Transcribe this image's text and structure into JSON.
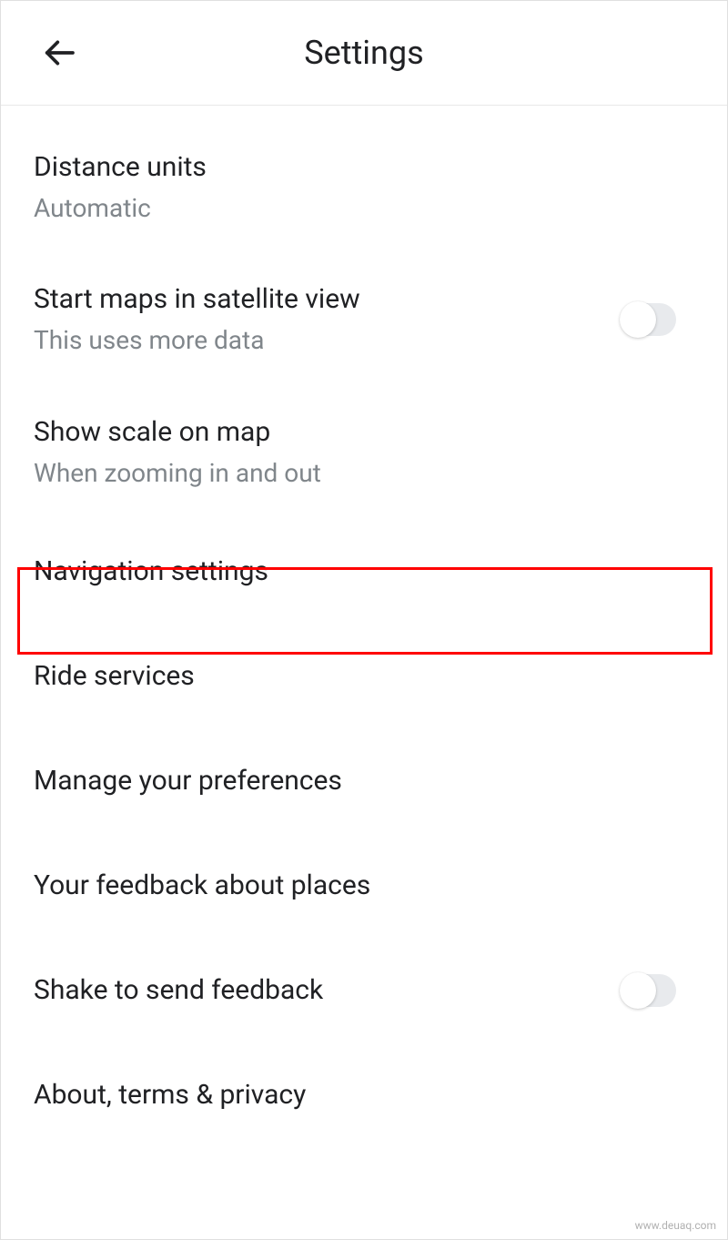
{
  "header": {
    "title": "Settings"
  },
  "items": [
    {
      "title": "Distance units",
      "subtitle": "Automatic",
      "hasToggle": false
    },
    {
      "title": "Start maps in satellite view",
      "subtitle": "This uses more data",
      "hasToggle": true,
      "toggleOn": false
    },
    {
      "title": "Show scale on map",
      "subtitle": "When zooming in and out",
      "hasToggle": false
    },
    {
      "title": "Navigation settings",
      "subtitle": null,
      "hasToggle": false,
      "highlighted": true
    },
    {
      "title": "Ride services",
      "subtitle": null,
      "hasToggle": false
    },
    {
      "title": "Manage your preferences",
      "subtitle": null,
      "hasToggle": false
    },
    {
      "title": "Your feedback about places",
      "subtitle": null,
      "hasToggle": false
    },
    {
      "title": "Shake to send feedback",
      "subtitle": null,
      "hasToggle": true,
      "toggleOn": false
    },
    {
      "title": "About, terms & privacy",
      "subtitle": null,
      "hasToggle": false
    }
  ],
  "watermark": "www.deuaq.com"
}
